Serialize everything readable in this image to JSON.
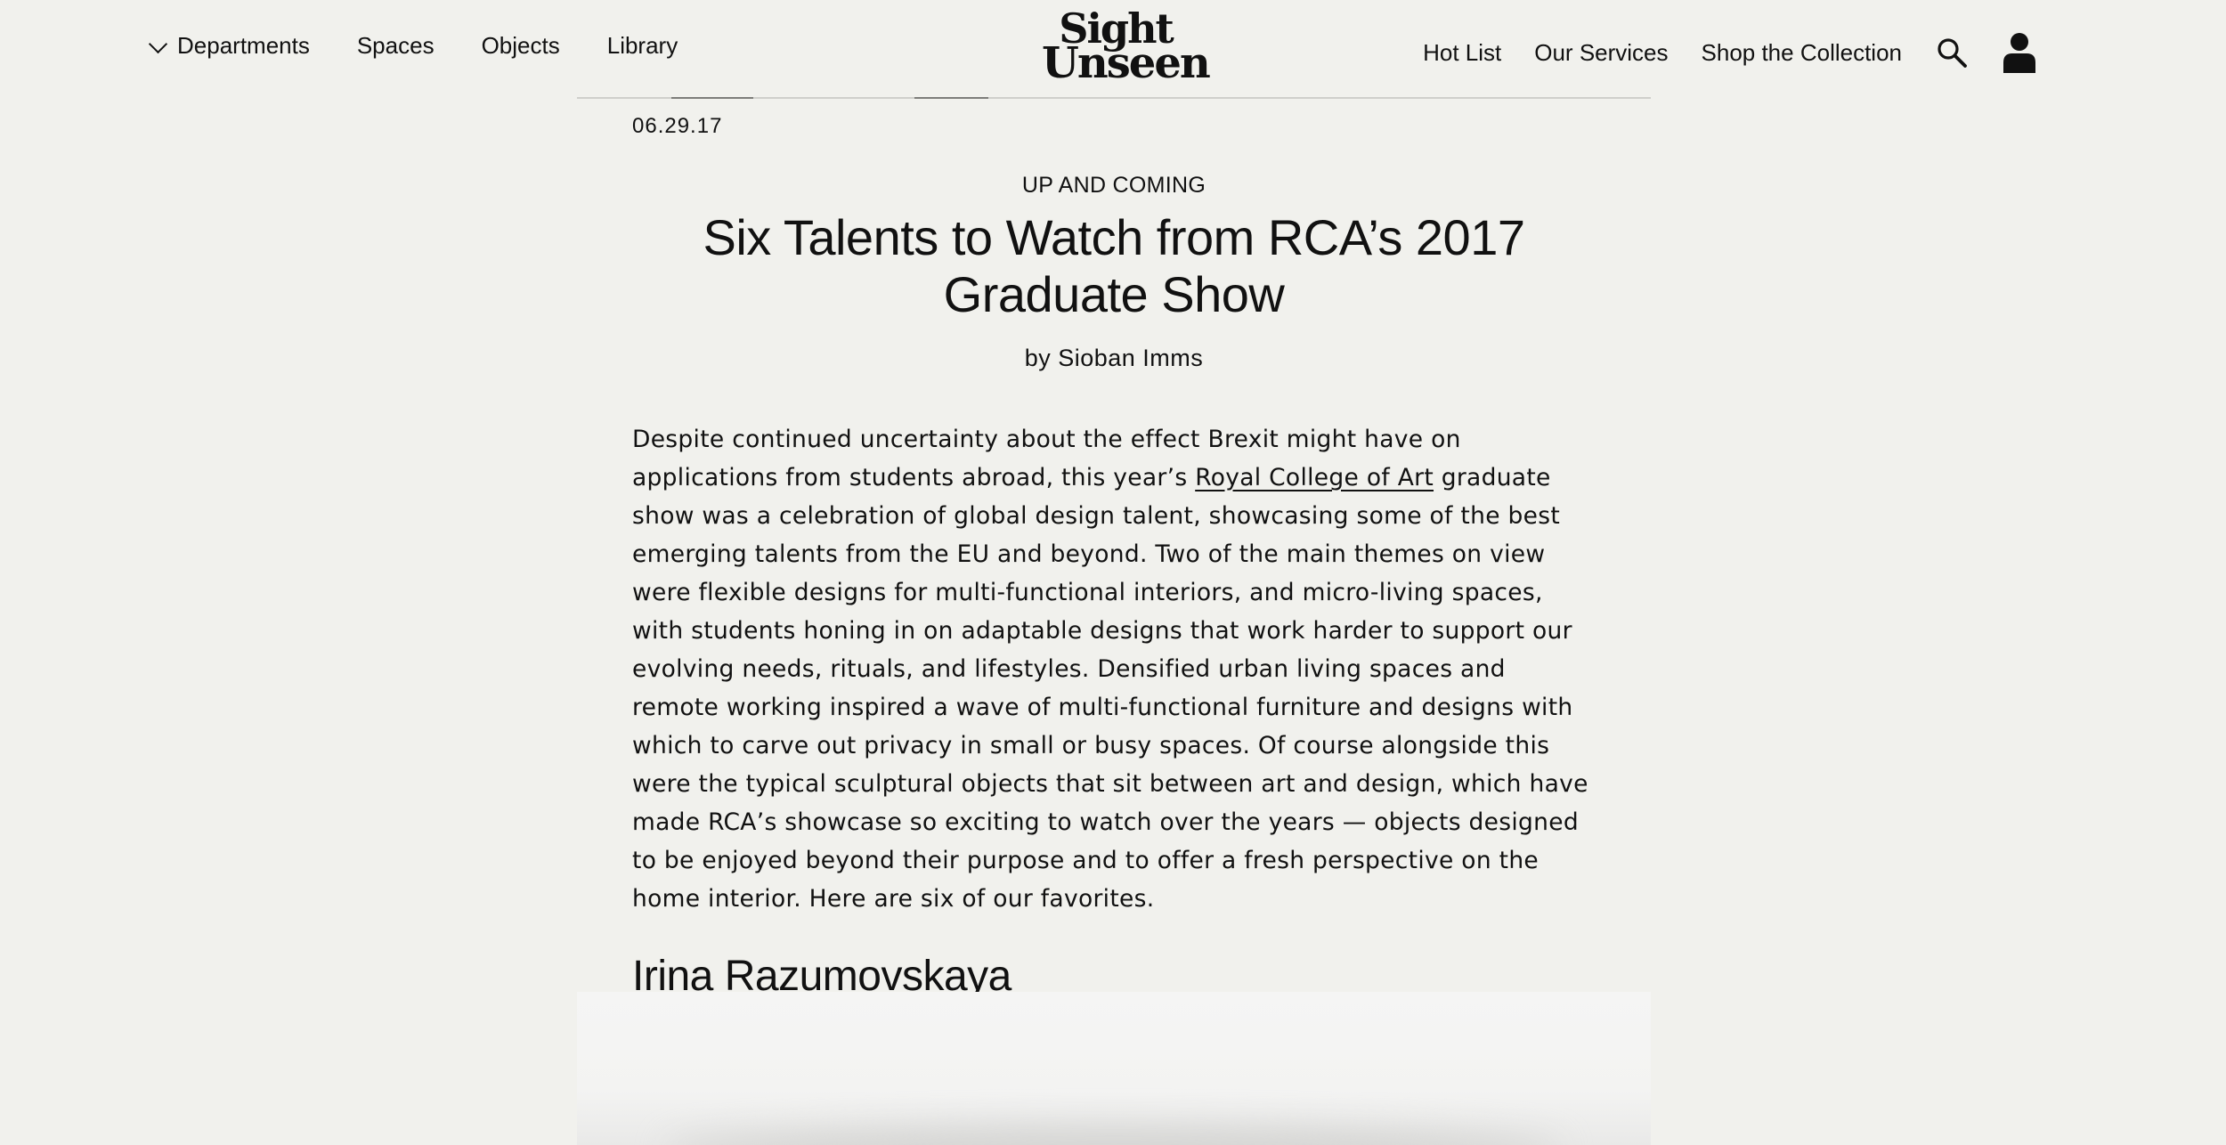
{
  "nav": {
    "departments_label": "Departments",
    "left_links": [
      "Spaces",
      "Objects",
      "Library"
    ],
    "right_links": [
      "Hot List",
      "Our Services",
      "Shop the Collection"
    ],
    "logo_line1": "Sight",
    "logo_line2": "Unseen",
    "icons": [
      "chevron-down-icon",
      "search-icon",
      "user-icon"
    ]
  },
  "article": {
    "date": "06.29.17",
    "kicker": "UP AND COMING",
    "title": "Six Talents to Watch from RCA’s 2017 Graduate Show",
    "byline": "by Sioban Imms",
    "intro_before_link": "Despite continued uncertainty about the effect Brexit might have on applications from students abroad, this year’s ",
    "link_text": "Royal College of Art",
    "intro_after_link": " graduate show was a celebration of global design talent, showcasing some of the best emerging talents from the EU and beyond. Two of the main themes on view were flexible designs for multi-functional interiors, and micro-living spaces, with students honing in on adaptable designs that work harder to support our evolving needs, rituals, and lifestyles. Densified urban living spaces and remote working inspired a wave of multi-functional furniture and designs with which to carve out privacy in small or busy spaces. Of course alongside this were the typical sculptural objects that sit between art and design, which have made RCA’s showcase so exciting to watch over the years — objects designed to be enjoyed beyond their purpose and to offer a fresh perspective on the home interior. Here are six of our favorites.",
    "section_heading": "Irina Razumovskaya"
  },
  "colors": {
    "background": "#f1f1ed",
    "text": "#111111"
  }
}
